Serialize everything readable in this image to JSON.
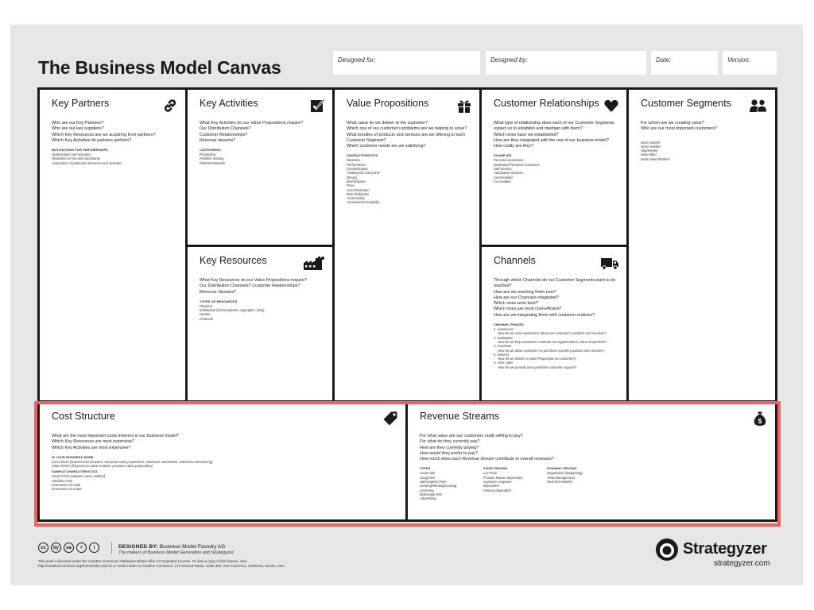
{
  "title": "The Business Model Canvas",
  "meta": {
    "designed_for": "Designed for:",
    "designed_by": "Designed by:",
    "date": "Date:",
    "version": "Version:"
  },
  "blocks": {
    "key_partners": {
      "title": "Key Partners",
      "icon": "link-icon",
      "questions": [
        "Who are our Key Partners?",
        "Who are our key suppliers?",
        "Which Key Resources are we acquiring from partners?",
        "Which Key Activities do partners perform?"
      ],
      "sub_heading": "MOTIVATIONS FOR PARTNERSHIPS",
      "items": [
        "Optimization and economy",
        "Reduction of risk and uncertainty",
        "Acquisition of particular resources and activities"
      ]
    },
    "key_activities": {
      "title": "Key Activities",
      "icon": "checkbox-icon",
      "questions": [
        "What Key Activities do our Value Propositions require?",
        "Our Distribution Channels?",
        "Customer Relationships?",
        "Revenue streams?"
      ],
      "sub_heading": "CATEGORIES",
      "items": [
        "Production",
        "Problem Solving",
        "Platform/Network"
      ]
    },
    "key_resources": {
      "title": "Key Resources",
      "icon": "factory-icon",
      "questions": [
        "What Key Resources do our Value Propositions require?",
        "Our Distribution Channels? Customer Relationships?",
        "Revenue Streams?"
      ],
      "sub_heading": "TYPES OF RESOURCES",
      "items": [
        "Physical",
        "Intellectual (brand patents, copyrights, data)",
        "Human",
        "Financial"
      ]
    },
    "value_propositions": {
      "title": "Value Propositions",
      "icon": "gift-icon",
      "questions": [
        "What value do we deliver to the customer?",
        "Which one of our customer's problems are we helping to solve?",
        "What bundles of products and services are we offering to each Customer Segment?",
        "Which customer needs are we satisfying?"
      ],
      "sub_heading": "CHARACTERISTICS",
      "items": [
        "Newness",
        "Performance",
        "Customization",
        "\"Getting the Job Done\"",
        "Design",
        "Brand/Status",
        "Price",
        "Cost Reduction",
        "Risk Reduction",
        "Accessibility",
        "Convenience/Usability"
      ]
    },
    "customer_relationships": {
      "title": "Customer Relationships",
      "icon": "heart-icon",
      "questions": [
        "What type of relationship does each of our Customer Segments expect us to establish and maintain with them?",
        "Which ones have we established?",
        "How are they integrated with the rest of our business model?",
        "How costly are they?"
      ],
      "sub_heading": "EXAMPLES",
      "items": [
        "Personal assistance",
        "Dedicated Personal Assistance",
        "Self-Service",
        "Automated Services",
        "Communities",
        "Co-creation"
      ]
    },
    "channels": {
      "title": "Channels",
      "icon": "truck-icon",
      "questions": [
        "Through which Channels do our Customer Segments want to be reached?",
        "How are we reaching them now?",
        "How are our Channels integrated?",
        "Which ones work best?",
        "Which ones are most cost-efficient?",
        "How are we integrating them with customer routines?"
      ],
      "sub_heading": "CHANNEL PHASES",
      "phases": [
        {
          "name": "1. Awareness",
          "desc": "How do we raise awareness about our company's products and services?"
        },
        {
          "name": "2. Evaluation",
          "desc": "How do we help customers evaluate our organization's Value Proposition?"
        },
        {
          "name": "3. Purchase",
          "desc": "How do we allow customers to purchase specific products and services?"
        },
        {
          "name": "4. Delivery",
          "desc": "How do we deliver a Value Proposition to customers?"
        },
        {
          "name": "5. After sales",
          "desc": "How do we provide post-purchase customer support?"
        }
      ]
    },
    "customer_segments": {
      "title": "Customer Segments",
      "icon": "people-icon",
      "questions": [
        "For whom are we creating value?",
        "Who are our most important customers?"
      ],
      "items": [
        "Mass Market",
        "Niche Market",
        "Segmented",
        "Diversified",
        "Multi-sided Platform"
      ]
    },
    "cost_structure": {
      "title": "Cost Structure",
      "icon": "price-tag-icon",
      "questions": [
        "What are the most important costs inherent in our business model?",
        "Which Key Resources are most expensive?",
        "Which Key Activities are most expensive?"
      ],
      "sub_heading": "IS YOUR BUSINESS MORE",
      "items": [
        "Cost Driven (leanest cost structure, low price value proposition, maximum automation, extensive outsourcing)",
        "Value Driven (focused on value creation, premium value proposition)"
      ],
      "sub_heading_2": "SAMPLE CHARACTERISTICS",
      "items_2": [
        "Fixed Costs (salaries, rents, utilities)",
        "Variable costs",
        "Economies of scale",
        "Economies of scope"
      ]
    },
    "revenue_streams": {
      "title": "Revenue Streams",
      "icon": "money-bag-icon",
      "questions": [
        "For what value are our customers really willing to pay?",
        "For what do they currently pay?",
        "How are they currently paying?",
        "How would they prefer to pay?",
        "How much does each Revenue Stream contribute to overall revenues?"
      ],
      "columns": [
        {
          "heading": "TYPES",
          "items": [
            "Asset sale",
            "Usage fee",
            "Subscription Fees",
            "Lending/Renting/Leasing",
            "Licensing",
            "Brokerage fees",
            "Advertising"
          ]
        },
        {
          "heading": "FIXED PRICING",
          "items": [
            "List Price",
            "Product feature dependent",
            "Customer segment",
            "dependent",
            "Volume dependent"
          ]
        },
        {
          "heading": "DYNAMIC PRICING",
          "items": [
            "Negotiation (bargaining)",
            "Yield Management",
            "Real-time-Market"
          ]
        }
      ]
    }
  },
  "footer": {
    "license_icons": [
      "cc",
      "by",
      "sa",
      "=",
      "i"
    ],
    "designed_by_label": "DESIGNED BY:",
    "designed_by_value": "Business Model Foundry AG",
    "makers": "The makers of Business Model Generation and Strategyzer",
    "license_text": "This work is licensed under the Creative Commons Attribution-Share Alike 3.0 Unported License. To view a copy of this license, visit: http://creativecommons.org/licenses/by-sa/3.0/ or send a letter to Creative Commons, 171 Second Street, Suite 300, San Francisco, California, 94105, USA.",
    "brand": "Strategyzer",
    "brand_url": "strategyzer.com"
  },
  "colors": {
    "sheet": "#e6e6e6",
    "grid_lines": "#1a1a1a",
    "highlight": "#f06060"
  }
}
